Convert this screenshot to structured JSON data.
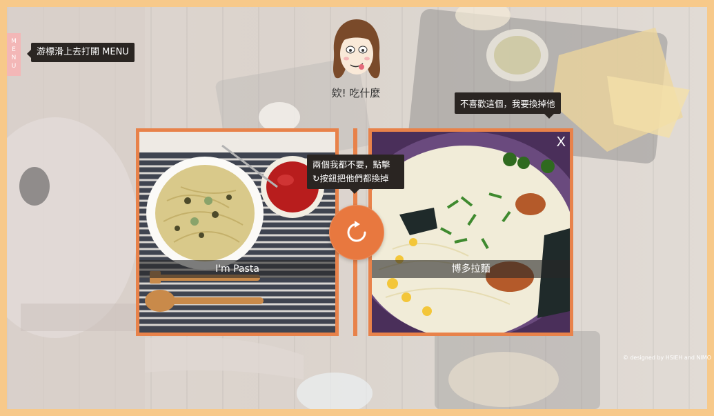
{
  "menu": {
    "letters": [
      "M",
      "E",
      "N",
      "U"
    ],
    "tooltip": "游標滑上去打開 MENU"
  },
  "header": {
    "caption": "欸! 吃什麼"
  },
  "tooltips": {
    "replace_one": "不喜歡這個，我要換掉他",
    "replace_both_line1": "兩個我都不要，點擊",
    "replace_both_line2": "按鈕把他們都換掉"
  },
  "cards": {
    "left": {
      "label": "I'm Pasta"
    },
    "right": {
      "label": "博多拉麵",
      "close": "X"
    }
  },
  "footer": {
    "credit": "© designed by HSIEH and NIMO"
  },
  "colors": {
    "frame": "#f7c98a",
    "accent": "#e8824a",
    "tooltip_bg": "#2a2522",
    "menu_tab": "#f3b7b7"
  },
  "icons": {
    "refresh": "refresh-icon"
  }
}
